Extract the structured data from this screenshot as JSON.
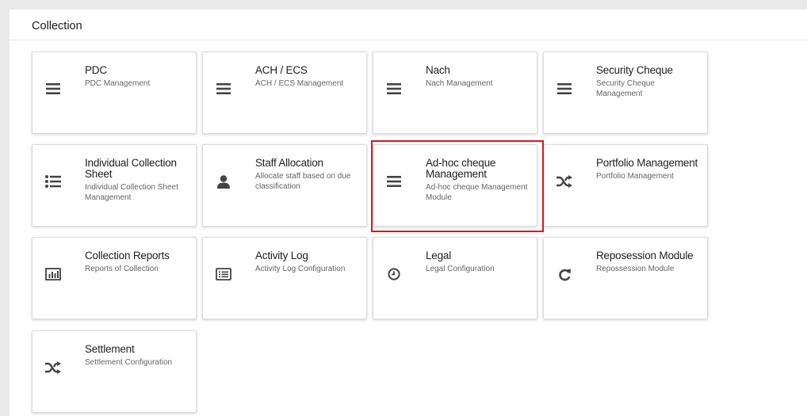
{
  "section": {
    "title": "Collection"
  },
  "cards": [
    {
      "title": "PDC",
      "description": "PDC Management",
      "icon": "bars-icon"
    },
    {
      "title": "ACH / ECS",
      "description": "ACH / ECS Management",
      "icon": "bars-icon"
    },
    {
      "title": "Nach",
      "description": "Nach Management",
      "icon": "bars-icon"
    },
    {
      "title": "Security Cheque",
      "description": "Security Cheque Management",
      "icon": "bars-icon"
    },
    {
      "title": "Individual Collection Sheet",
      "description": "Individual Collection Sheet Management",
      "icon": "list-icon"
    },
    {
      "title": "Staff Allocation",
      "description": "Allocate staff based on due classification",
      "icon": "user-icon"
    },
    {
      "title": "Ad-hoc cheque Management",
      "description": "Ad-hoc cheque Management Module",
      "icon": "bars-icon"
    },
    {
      "title": "Portfolio Management",
      "description": "Portfolio Management",
      "icon": "shuffle-icon"
    },
    {
      "title": "Collection Reports",
      "description": "Reports of Collection",
      "icon": "bar-chart-icon"
    },
    {
      "title": "Activity Log",
      "description": "Activity Log Configuration",
      "icon": "list-alt-icon"
    },
    {
      "title": "Legal",
      "description": "Legal Configuration",
      "icon": "clock-icon"
    },
    {
      "title": "Reposession Module",
      "description": "Repossession Module",
      "icon": "refresh-icon"
    },
    {
      "title": "Settlement",
      "description": "Settlement Configuration",
      "icon": "shuffle-icon"
    }
  ],
  "highlight_color": "#e0151b"
}
